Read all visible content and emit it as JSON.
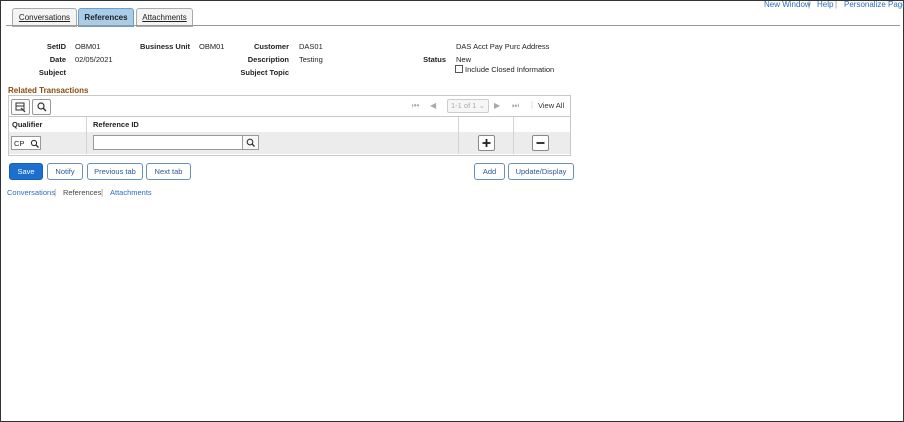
{
  "top_links": {
    "new_window": "New Window",
    "help": "Help",
    "personalize": "Personalize Page",
    "separator": "|"
  },
  "tabs": [
    {
      "label": "Conversations"
    },
    {
      "label": "References"
    },
    {
      "label": "Attachments"
    }
  ],
  "form": {
    "setid_label": "SetID",
    "setid_value": "OBM01",
    "business_unit_label": "Business Unit",
    "business_unit_value": "OBM01",
    "customer_label": "Customer",
    "customer_value": "DAS01",
    "customer_name": "DAS Acct Pay Purc Address",
    "date_label": "Date",
    "date_value": "02/05/2021",
    "description_label": "Description",
    "description_value": "Testing",
    "status_label": "Status",
    "status_value": "New",
    "subject_label": "Subject",
    "subject_topic_label": "Subject Topic",
    "include_closed_label": "Include Closed Information"
  },
  "related": {
    "title": "Related Transactions",
    "pagination": "1-1 of 1",
    "view_all": "View All",
    "columns": [
      "Qualifier",
      "Reference ID"
    ],
    "rows": [
      {
        "qualifier": "CP",
        "reference_id": ""
      }
    ]
  },
  "buttons": {
    "save": "Save",
    "notify": "Notify",
    "previous_tab": "Previous tab",
    "next_tab": "Next tab",
    "add": "Add",
    "update_display": "Update/Display"
  },
  "bottom_links": {
    "conversations": "Conversations",
    "references": "References",
    "attachments": "Attachments",
    "separator": "|"
  }
}
